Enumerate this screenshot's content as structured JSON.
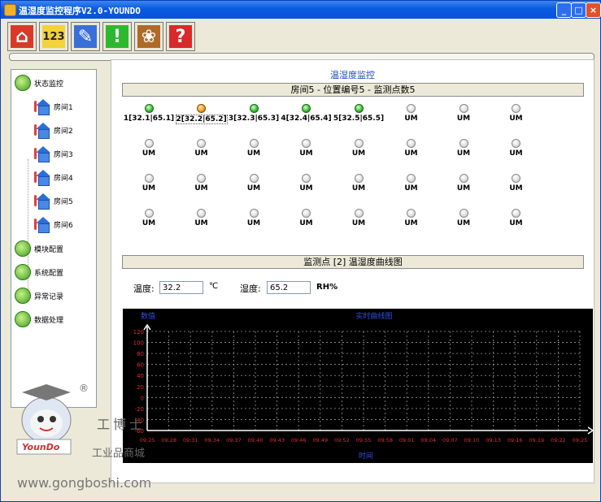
{
  "window": {
    "title": "温湿度监控程序V2.0-YOUNDO",
    "minimize": "_",
    "maximize": "□",
    "close": "×"
  },
  "toolbar": {
    "buttons": [
      {
        "name": "home",
        "glyph": "⌂",
        "color": "#d83a2a"
      },
      {
        "name": "numbers",
        "glyph": "123",
        "color": "#f3d23a"
      },
      {
        "name": "edit",
        "glyph": "✎",
        "color": "#3a6fd8"
      },
      {
        "name": "alert",
        "glyph": "!",
        "color": "#2eb82e"
      },
      {
        "name": "paw",
        "glyph": "❀",
        "color": "#b06a28"
      },
      {
        "name": "help",
        "glyph": "?",
        "color": "#d82a2a"
      }
    ]
  },
  "sidebar": {
    "status": "状态监控",
    "rooms": [
      "房间1",
      "房间2",
      "房间3",
      "房间4",
      "房间5",
      "房间6"
    ],
    "items": [
      "模块配置",
      "系统配置",
      "异常记录",
      "数据处理"
    ]
  },
  "main": {
    "title": "温湿度监控",
    "info_bar": "房间5 - 位置编号5 - 监测点数5",
    "sensors": [
      {
        "label": "1[32.1|65.1]",
        "state": "green"
      },
      {
        "label": "2[32.2|65.2]",
        "state": "orange",
        "selected": true
      },
      {
        "label": "3[32.3|65.3]",
        "state": "green"
      },
      {
        "label": "4[32.4|65.4]",
        "state": "green"
      },
      {
        "label": "5[32.5|65.5]",
        "state": "green"
      },
      {
        "label": "UM",
        "state": "off"
      },
      {
        "label": "UM",
        "state": "off"
      },
      {
        "label": "UM",
        "state": "off"
      },
      {
        "label": "UM",
        "state": "off"
      },
      {
        "label": "UM",
        "state": "off"
      },
      {
        "label": "UM",
        "state": "off"
      },
      {
        "label": "UM",
        "state": "off"
      },
      {
        "label": "UM",
        "state": "off"
      },
      {
        "label": "UM",
        "state": "off"
      },
      {
        "label": "UM",
        "state": "off"
      },
      {
        "label": "UM",
        "state": "off"
      },
      {
        "label": "UM",
        "state": "off"
      },
      {
        "label": "UM",
        "state": "off"
      },
      {
        "label": "UM",
        "state": "off"
      },
      {
        "label": "UM",
        "state": "off"
      },
      {
        "label": "UM",
        "state": "off"
      },
      {
        "label": "UM",
        "state": "off"
      },
      {
        "label": "UM",
        "state": "off"
      },
      {
        "label": "UM",
        "state": "off"
      },
      {
        "label": "UM",
        "state": "off"
      },
      {
        "label": "UM",
        "state": "off"
      },
      {
        "label": "UM",
        "state": "off"
      },
      {
        "label": "UM",
        "state": "off"
      },
      {
        "label": "UM",
        "state": "off"
      },
      {
        "label": "UM",
        "state": "off"
      },
      {
        "label": "UM",
        "state": "off"
      },
      {
        "label": "UM",
        "state": "off"
      }
    ],
    "curve_bar": "监测点 [2] 温湿度曲线图",
    "temp_label": "温度:",
    "temp_value": "32.2",
    "temp_unit": "℃",
    "hum_label": "湿度:",
    "hum_value": "65.2",
    "hum_unit": "RH%"
  },
  "chart_data": {
    "type": "line",
    "title": "实时曲线图",
    "ylabel": "数值",
    "xlabel": "时间",
    "ylim": [
      -60,
      120
    ],
    "yticks": [
      120,
      100,
      80,
      60,
      40,
      20,
      0,
      -20,
      -40,
      -60
    ],
    "categories": [
      "09:25",
      "09:28",
      "09:31",
      "09:34",
      "09:37",
      "09:40",
      "09:43",
      "09:46",
      "09:49",
      "09:52",
      "09:55",
      "09:58",
      "09:01",
      "09:04",
      "09:07",
      "09:10",
      "09:13",
      "09:16",
      "09:19",
      "09:22",
      "09:25"
    ],
    "grid": true,
    "series": [],
    "colors": {
      "background": "#000000",
      "grid": "#9a9a9a",
      "axis": "#ffffff",
      "ticks": "#e03030",
      "labels": "#3050e0"
    }
  },
  "watermark": {
    "company": "工博士",
    "mall": "工业品商城",
    "url": "www.gongboshi.com",
    "brand": "YounDo",
    "registered": "®"
  }
}
